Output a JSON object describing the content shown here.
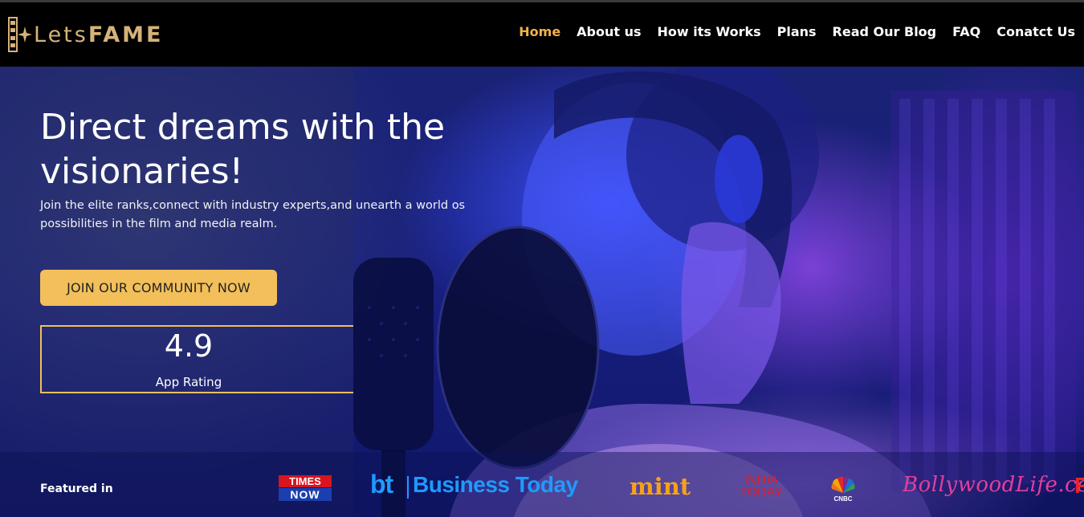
{
  "brand": {
    "name_part1": "Lets",
    "name_part2": "FAME",
    "accent_color": "#f0b24a",
    "logo_color": "#d6b27a"
  },
  "nav": {
    "items": [
      {
        "label": "Home",
        "active": true
      },
      {
        "label": "About us",
        "active": false
      },
      {
        "label": "How its Works",
        "active": false
      },
      {
        "label": "Plans",
        "active": false
      },
      {
        "label": "Read Our Blog",
        "active": false
      },
      {
        "label": "FAQ",
        "active": false
      },
      {
        "label": "Conatct Us",
        "active": false
      }
    ]
  },
  "hero": {
    "headline_line1": "Direct dreams with the",
    "headline_line2": "visionaries!",
    "subtext": "Join the elite ranks,connect with industry experts,and unearth a world os possibilities in the film and media realm.",
    "cta_label": "JOIN OUR COMMUNITY NOW",
    "cta_color": "#f2bf5a",
    "rating_value": "4.9",
    "rating_label": "App Rating"
  },
  "featured": {
    "label": "Featured in",
    "logos": [
      {
        "name": "times-now",
        "text_top": "TIMES",
        "text_bottom": "NOW"
      },
      {
        "name": "business-today",
        "text_short": "bt",
        "text": "Business Today"
      },
      {
        "name": "mint",
        "text": "mint"
      },
      {
        "name": "india-today",
        "text_top": "INDIA",
        "text_bottom": "TODAY"
      },
      {
        "name": "cnbc",
        "text": "CNBC"
      },
      {
        "name": "bollywoodlife",
        "text": "BollywoodLife.com"
      },
      {
        "name": "cut-off-logo",
        "text": "F"
      }
    ]
  }
}
